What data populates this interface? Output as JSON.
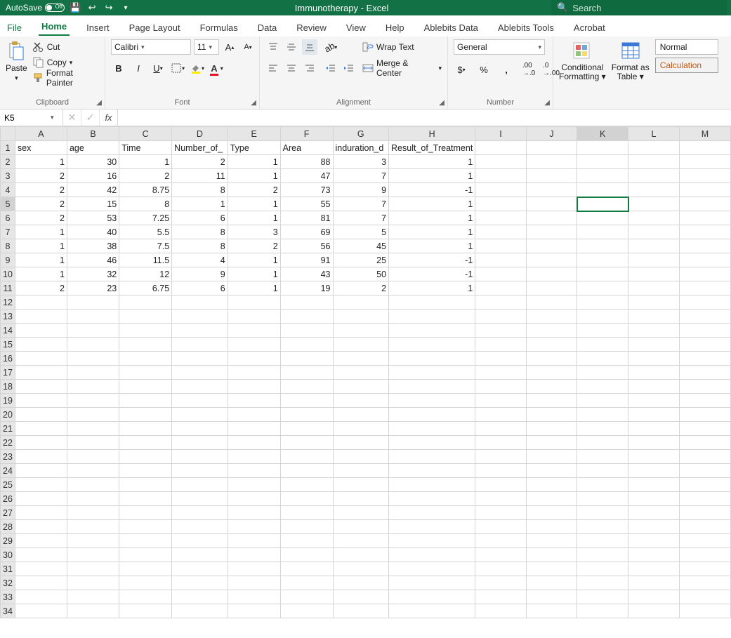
{
  "titlebar": {
    "autosave_label": "AutoSave",
    "autosave_state": "Off",
    "doc_title": "Immunotherapy  -  Excel",
    "search_placeholder": "Search"
  },
  "tabs": [
    "File",
    "Home",
    "Insert",
    "Page Layout",
    "Formulas",
    "Data",
    "Review",
    "View",
    "Help",
    "Ablebits Data",
    "Ablebits Tools",
    "Acrobat"
  ],
  "active_tab": "Home",
  "ribbon": {
    "clipboard": {
      "paste": "Paste",
      "cut": "Cut",
      "copy": "Copy",
      "format_painter": "Format Painter",
      "label": "Clipboard"
    },
    "font": {
      "name": "Calibri",
      "size": "11",
      "label": "Font"
    },
    "alignment": {
      "wrap": "Wrap Text",
      "merge": "Merge & Center",
      "label": "Alignment"
    },
    "number": {
      "format": "General",
      "label": "Number"
    },
    "styles": {
      "conditional": "Conditional\nFormatting",
      "format_as_table": "Format as\nTable",
      "normal": "Normal",
      "calculation": "Calculation"
    }
  },
  "namebox_value": "K5",
  "formula_value": "",
  "columns": [
    "A",
    "B",
    "C",
    "D",
    "E",
    "F",
    "G",
    "H",
    "I",
    "J",
    "K",
    "L",
    "M"
  ],
  "selected_cell": {
    "col": "K",
    "row": 5
  },
  "headers": [
    "sex",
    "age",
    "Time",
    "Number_of_",
    "Type",
    "Area",
    "induration_d",
    "Result_of_Treatment"
  ],
  "data_rows": [
    [
      1,
      30,
      1,
      2,
      1,
      88,
      3,
      1
    ],
    [
      2,
      16,
      2,
      11,
      1,
      47,
      7,
      1
    ],
    [
      2,
      42,
      8.75,
      8,
      2,
      73,
      9,
      -1
    ],
    [
      2,
      15,
      8,
      1,
      1,
      55,
      7,
      1
    ],
    [
      2,
      53,
      7.25,
      6,
      1,
      81,
      7,
      1
    ],
    [
      1,
      40,
      5.5,
      8,
      3,
      69,
      5,
      1
    ],
    [
      1,
      38,
      7.5,
      8,
      2,
      56,
      45,
      1
    ],
    [
      1,
      46,
      11.5,
      4,
      1,
      91,
      25,
      -1
    ],
    [
      1,
      32,
      12,
      9,
      1,
      43,
      50,
      -1
    ],
    [
      2,
      23,
      6.75,
      6,
      1,
      19,
      2,
      1
    ]
  ],
  "total_rows": 34
}
